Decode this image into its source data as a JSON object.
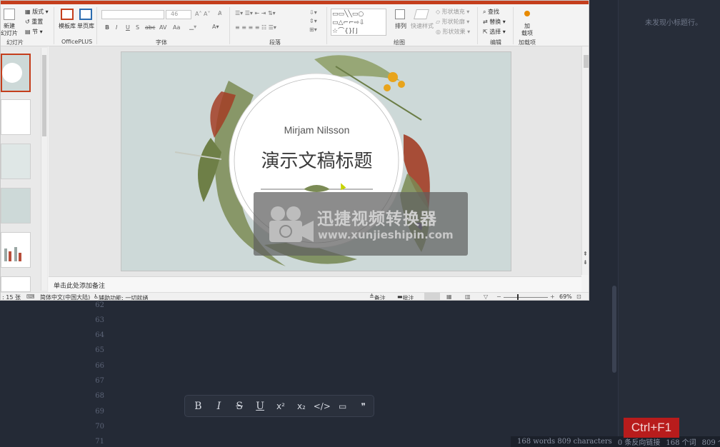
{
  "editor": {
    "line_numbers": [
      "62",
      "63",
      "64",
      "65",
      "66",
      "67",
      "68",
      "69",
      "70",
      "71"
    ],
    "outline_empty_text": "未发现小标题行。",
    "status_words": "168 words 809 characters",
    "status_links": "0 条反向链接",
    "status_cn_words": "168 个词",
    "status_cn_chars": "809 个字符",
    "shortcut_badge": "Ctrl+F1",
    "format_toolbar": [
      {
        "name": "bold-button",
        "glyph": "B"
      },
      {
        "name": "italic-button",
        "glyph": "I"
      },
      {
        "name": "strikethrough-button",
        "glyph": "S"
      },
      {
        "name": "underline-button",
        "glyph": "U"
      },
      {
        "name": "superscript-button",
        "glyph": "x²"
      },
      {
        "name": "subscript-button",
        "glyph": "x₂"
      },
      {
        "name": "code-button",
        "glyph": "</>"
      },
      {
        "name": "codeblock-button",
        "glyph": "▭"
      },
      {
        "name": "quote-button",
        "glyph": "❞"
      }
    ]
  },
  "ppt": {
    "ribbon": {
      "new_slide": "新建",
      "new_slide_2": "幻灯片",
      "layout": "版式",
      "reset": "重置",
      "section": "节",
      "group_slides": "幻灯片",
      "template_lib": "模板库",
      "single_lib": "单页库",
      "group_officeplus": "OfficePLUS",
      "font_size": "46",
      "group_font": "字体",
      "group_paragraph": "段落",
      "arrange": "排列",
      "quick_styles": "快速样式",
      "shape_fill": "形状填充",
      "shape_outline": "形状轮廓",
      "shape_effect": "形状效果",
      "group_drawing": "绘图",
      "find": "查找",
      "replace": "替换",
      "select": "选择",
      "group_editing": "编辑",
      "addins": "加",
      "addins_2": "载项",
      "group_addins": "加载项"
    },
    "slide": {
      "subtitle": "Mirjam Nilsson",
      "title": "演示文稿标题"
    },
    "watermark": {
      "title": "迅捷视频转换器",
      "url": "www.xunjieshipin.com"
    },
    "notes_placeholder": "单击此处添加备注",
    "status": {
      "slide_count": ": 15 张",
      "language": "简体中文(中国大陆)",
      "accessibility": "辅助功能: 一切就绪",
      "notes": "备注",
      "comments": "批注",
      "zoom": "69%"
    },
    "colors": {
      "accent": "#c43e1c",
      "slide_bg": "#cdd9d8"
    }
  }
}
